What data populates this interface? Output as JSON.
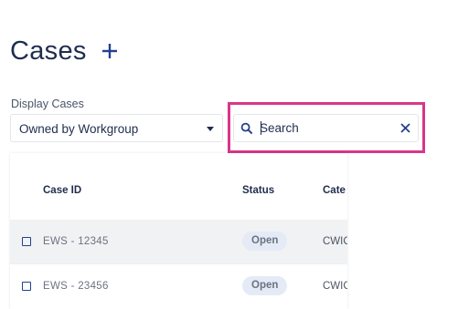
{
  "page": {
    "title": "Cases",
    "add_icon": "plus-icon"
  },
  "filters": {
    "display_label": "Display Cases",
    "display_selected": "Owned by Workgroup"
  },
  "search": {
    "placeholder": "Search",
    "value": "",
    "highlight_color": "#d9368b",
    "clear_icon": "close-icon"
  },
  "table": {
    "columns": [
      "Case ID",
      "Status",
      "Cate"
    ],
    "rows": [
      {
        "case_id": "EWS - 12345",
        "status": "Open",
        "category": "CWIC"
      },
      {
        "case_id": "EWS - 23456",
        "status": "Open",
        "category": "CWIC"
      }
    ]
  },
  "colors": {
    "primary": "#23408f",
    "text": "#1f2d4d",
    "badge_bg": "#e4ebf7"
  }
}
